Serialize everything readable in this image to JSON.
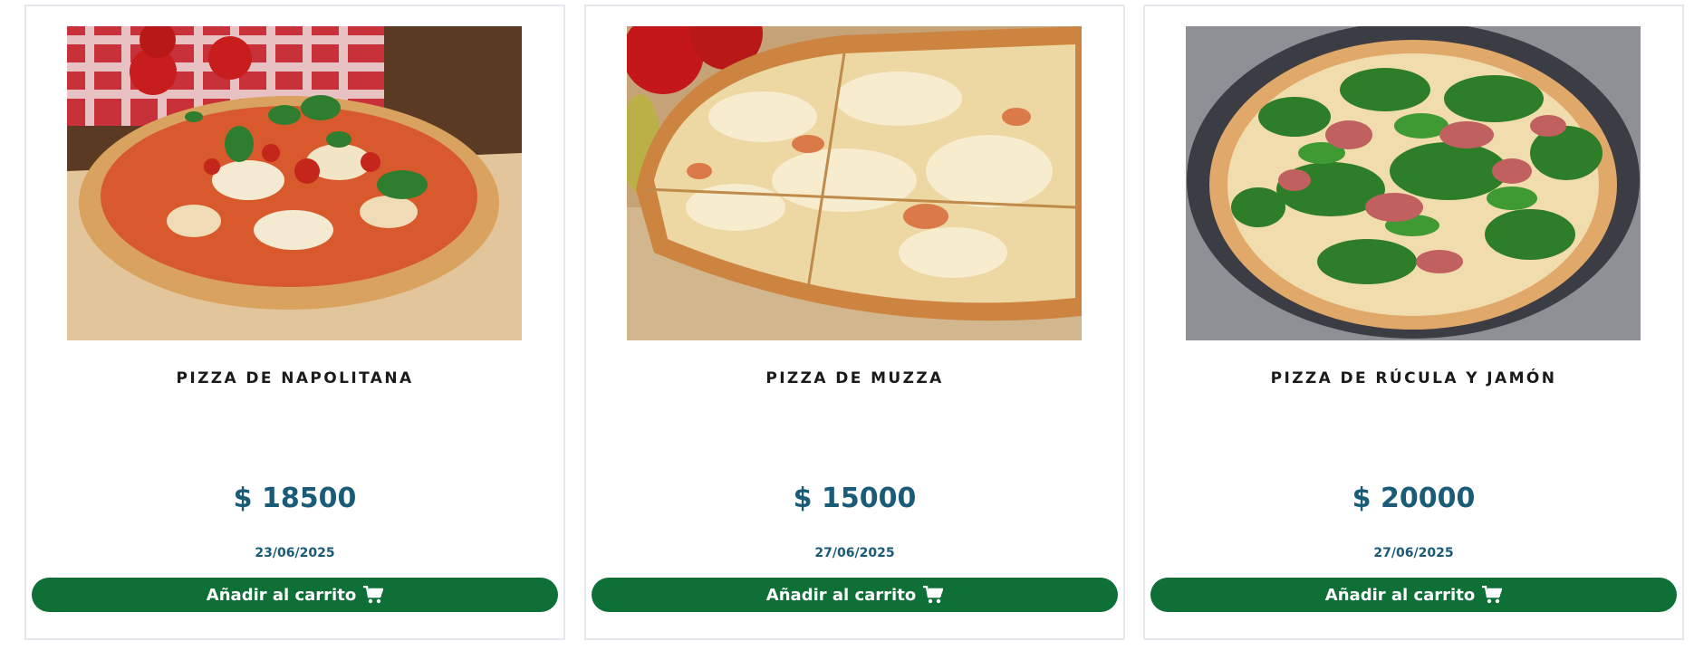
{
  "products": [
    {
      "image": "pizza-napolitana-photo",
      "name": "PIZZA DE NAPOLITANA",
      "price": "$ 18500",
      "date": "23/06/2025",
      "button_label": "Añadir al carrito"
    },
    {
      "image": "pizza-muzza-photo",
      "name": "PIZZA DE MUZZA",
      "price": "$ 15000",
      "date": "27/06/2025",
      "button_label": "Añadir al carrito"
    },
    {
      "image": "pizza-rucula-jamon-photo",
      "name": "PIZZA DE RÚCULA Y JAMÓN",
      "price": "$ 20000",
      "date": "27/06/2025",
      "button_label": "Añadir al carrito"
    }
  ],
  "icons": {
    "cart": "shopping-cart-icon"
  },
  "colors": {
    "button_bg": "#0e6f37",
    "price_text": "#1a5c78",
    "card_border": "#e5e8ec"
  }
}
